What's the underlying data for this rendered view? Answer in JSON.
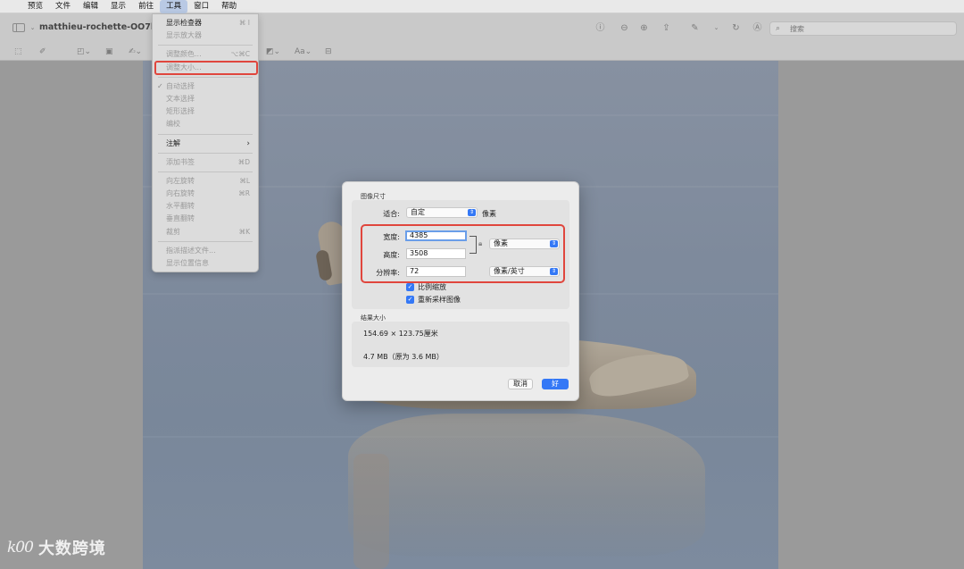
{
  "menubar": {
    "apple": "",
    "items": [
      "预览",
      "文件",
      "编辑",
      "显示",
      "前往",
      "工具",
      "窗口",
      "帮助"
    ],
    "active_index": 5
  },
  "toolbar": {
    "doc_title": "matthieu-rochette-OO7k3U",
    "search_placeholder": "搜索",
    "icons": [
      "sidebar-icon",
      "info-icon",
      "zoom-out-icon",
      "zoom-in-icon",
      "share-icon",
      "markup-icon",
      "rotate-icon",
      "annotate-icon",
      "search-icon"
    ],
    "row2_icons": [
      "selection-icon",
      "shape-icon",
      "text-icon",
      "sign-icon",
      "adjust-color-icon",
      "font-icon",
      "comment-icon"
    ]
  },
  "tools_menu": {
    "items": [
      {
        "label": "显示检查器",
        "shortcut": "⌘ I",
        "enabled": true
      },
      {
        "label": "显示放大器",
        "shortcut": "",
        "enabled": false
      },
      {
        "sep": true
      },
      {
        "label": "调整颜色...",
        "shortcut": "⌥⌘C",
        "enabled": false
      },
      {
        "label": "调整大小...",
        "shortcut": "",
        "enabled": false,
        "highlighted": true
      },
      {
        "sep": true
      },
      {
        "label": "自动选择",
        "shortcut": "",
        "enabled": false,
        "checked": true
      },
      {
        "label": "文本选择",
        "shortcut": "",
        "enabled": false
      },
      {
        "label": "矩形选择",
        "shortcut": "",
        "enabled": false
      },
      {
        "label": "编校",
        "shortcut": "",
        "enabled": false
      },
      {
        "sep": true
      },
      {
        "label": "注解",
        "shortcut": "",
        "enabled": true,
        "submenu": true
      },
      {
        "sep": true
      },
      {
        "label": "添加书签",
        "shortcut": "⌘D",
        "enabled": false
      },
      {
        "sep": true
      },
      {
        "label": "向左旋转",
        "shortcut": "⌘L",
        "enabled": false
      },
      {
        "label": "向右旋转",
        "shortcut": "⌘R",
        "enabled": false
      },
      {
        "label": "水平翻转",
        "shortcut": "",
        "enabled": false
      },
      {
        "label": "垂直翻转",
        "shortcut": "",
        "enabled": false
      },
      {
        "label": "裁剪",
        "shortcut": "⌘K",
        "enabled": false
      },
      {
        "sep": true
      },
      {
        "label": "指派描述文件...",
        "shortcut": "",
        "enabled": false
      },
      {
        "label": "显示位置信息",
        "shortcut": "",
        "enabled": false
      }
    ]
  },
  "dialog": {
    "image_size_title": "图像尺寸",
    "fit_label": "适合:",
    "fit_value": "自定",
    "fit_unit": "像素",
    "width_label": "宽度:",
    "width_value": "4385",
    "height_label": "高度:",
    "height_value": "3508",
    "size_unit": "像素",
    "resolution_label": "分辨率:",
    "resolution_value": "72",
    "resolution_unit": "像素/英寸",
    "scale_proportionally": "比例缩放",
    "resample_image": "重新采样图像",
    "result_title": "结果大小",
    "result_dimensions": "154.69 × 123.75厘米",
    "result_filesize": "4.7 MB（原为 3.6 MB）",
    "cancel_label": "取消",
    "ok_label": "好"
  },
  "watermark": {
    "logo": "k00",
    "text": "大数跨境"
  },
  "colors": {
    "accent": "#3478f6",
    "highlight_red": "#e0463d",
    "menu_active": "#b9c9e4"
  }
}
